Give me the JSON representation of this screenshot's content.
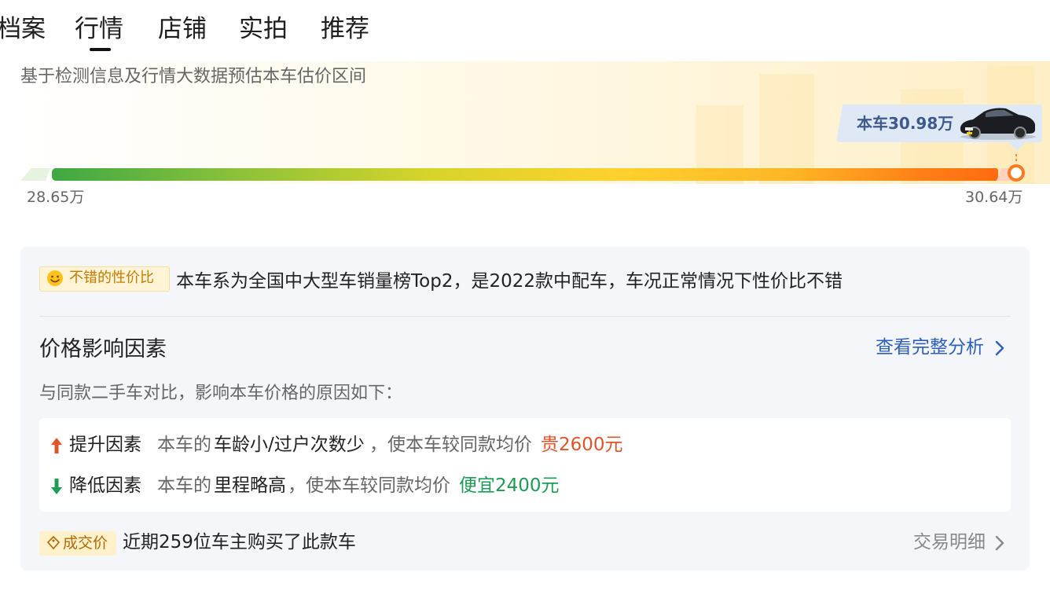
{
  "tabs": [
    {
      "label": "档案"
    },
    {
      "label": "行情",
      "active": true
    },
    {
      "label": "店铺"
    },
    {
      "label": "实拍"
    },
    {
      "label": "推荐"
    }
  ],
  "estimate": {
    "description": "基于检测信息及行情大数据预估本车估价区间",
    "current_price_label": "本车30.98万",
    "range_min": "28.65万",
    "range_max": "30.64万"
  },
  "summary": {
    "badge": "不错的性价比",
    "badge_icon": "smile-icon",
    "text": "本车系为全国中大型车销量榜Top2，是2022款中配车，车况正常情况下性价比不错"
  },
  "factors": {
    "title": "价格影响因素",
    "link": "查看完整分析",
    "subtitle": "与同款二手车对比，影响本车价格的原因如下：",
    "rows": [
      {
        "label": "提升因素",
        "icon": "arrow-up-icon",
        "prefix": "本车的",
        "highlight": "车龄小/过户次数少",
        "middle": "，使本车较同款均价",
        "result": "贵2600元",
        "result_color": "#e0542a"
      },
      {
        "label": "降低因素",
        "icon": "arrow-down-icon",
        "prefix": "本车的",
        "highlight": "里程略高",
        "middle": "，使本车较同款均价",
        "result": "便宜2400元",
        "result_color": "#1e9b55"
      }
    ]
  },
  "deal": {
    "badge": "成交价",
    "badge_icon": "price-tag-icon",
    "text": "近期259位车主购买了此款车",
    "link": "交易明细"
  },
  "colors": {
    "accent_orange": "#ff7a1f",
    "link_blue": "#2d5fb8",
    "up_red": "#e0542a",
    "down_green": "#1e9b55"
  }
}
